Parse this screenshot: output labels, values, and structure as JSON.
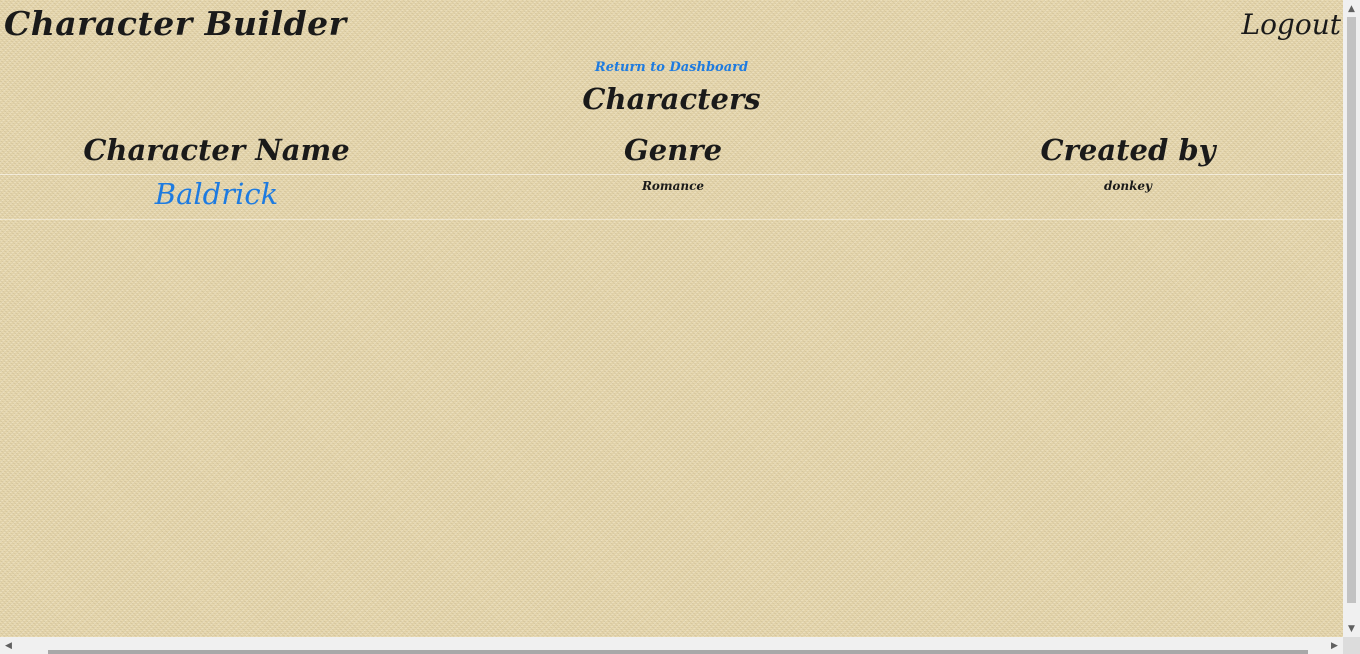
{
  "header": {
    "title": "Character Builder",
    "logout_label": "Logout"
  },
  "nav": {
    "dashboard_link": "Return to Dashboard"
  },
  "page": {
    "heading": "Characters"
  },
  "table": {
    "columns": [
      "Character Name",
      "Genre",
      "Created by"
    ],
    "rows": [
      {
        "name": "Baldrick",
        "genre": "Romance",
        "created_by": "donkey"
      }
    ]
  },
  "colors": {
    "background": "#e8d9b0",
    "link": "#1e7be0",
    "text": "#1a1a1a"
  },
  "icons": {
    "scroll_up": "scroll-up-arrow-icon",
    "scroll_down": "scroll-down-arrow-icon",
    "scroll_left": "scroll-left-arrow-icon",
    "scroll_right": "scroll-right-arrow-icon"
  }
}
